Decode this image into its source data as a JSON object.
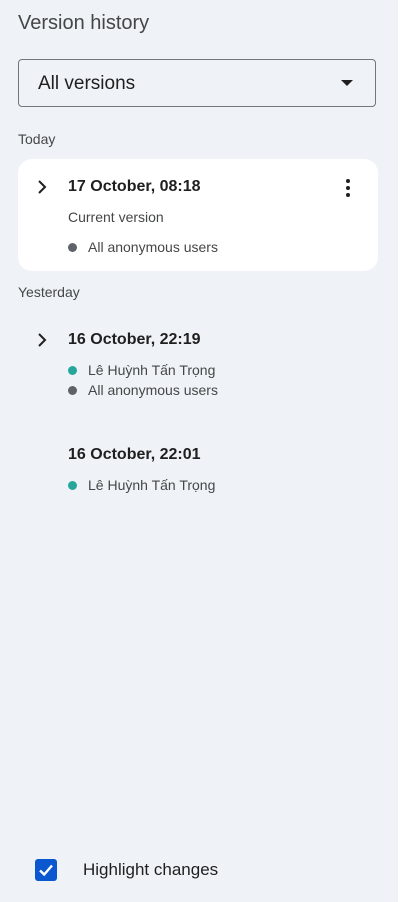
{
  "header": {
    "title": "Version history"
  },
  "filter": {
    "selected": "All versions"
  },
  "sections": {
    "today": "Today",
    "yesterday": "Yesterday"
  },
  "versions": [
    {
      "date": "17 October, 08:18",
      "label": "Current version",
      "users": [
        {
          "name": "All anonymous users",
          "color": "#5f6368"
        }
      ]
    },
    {
      "date": "16 October, 22:19",
      "users": [
        {
          "name": "Lê Huỳnh Tấn Trọng",
          "color": "#26a69a"
        },
        {
          "name": "All anonymous users",
          "color": "#5f6368"
        }
      ]
    },
    {
      "date": "16 October, 22:01",
      "users": [
        {
          "name": "Lê Huỳnh Tấn Trọng",
          "color": "#26a69a"
        }
      ]
    }
  ],
  "footer": {
    "highlight_label": "Highlight changes",
    "highlight_checked": true
  },
  "colors": {
    "accent": "#0b57d0",
    "background": "#eff3f8",
    "user_teal": "#26a69a",
    "user_gray": "#5f6368"
  }
}
